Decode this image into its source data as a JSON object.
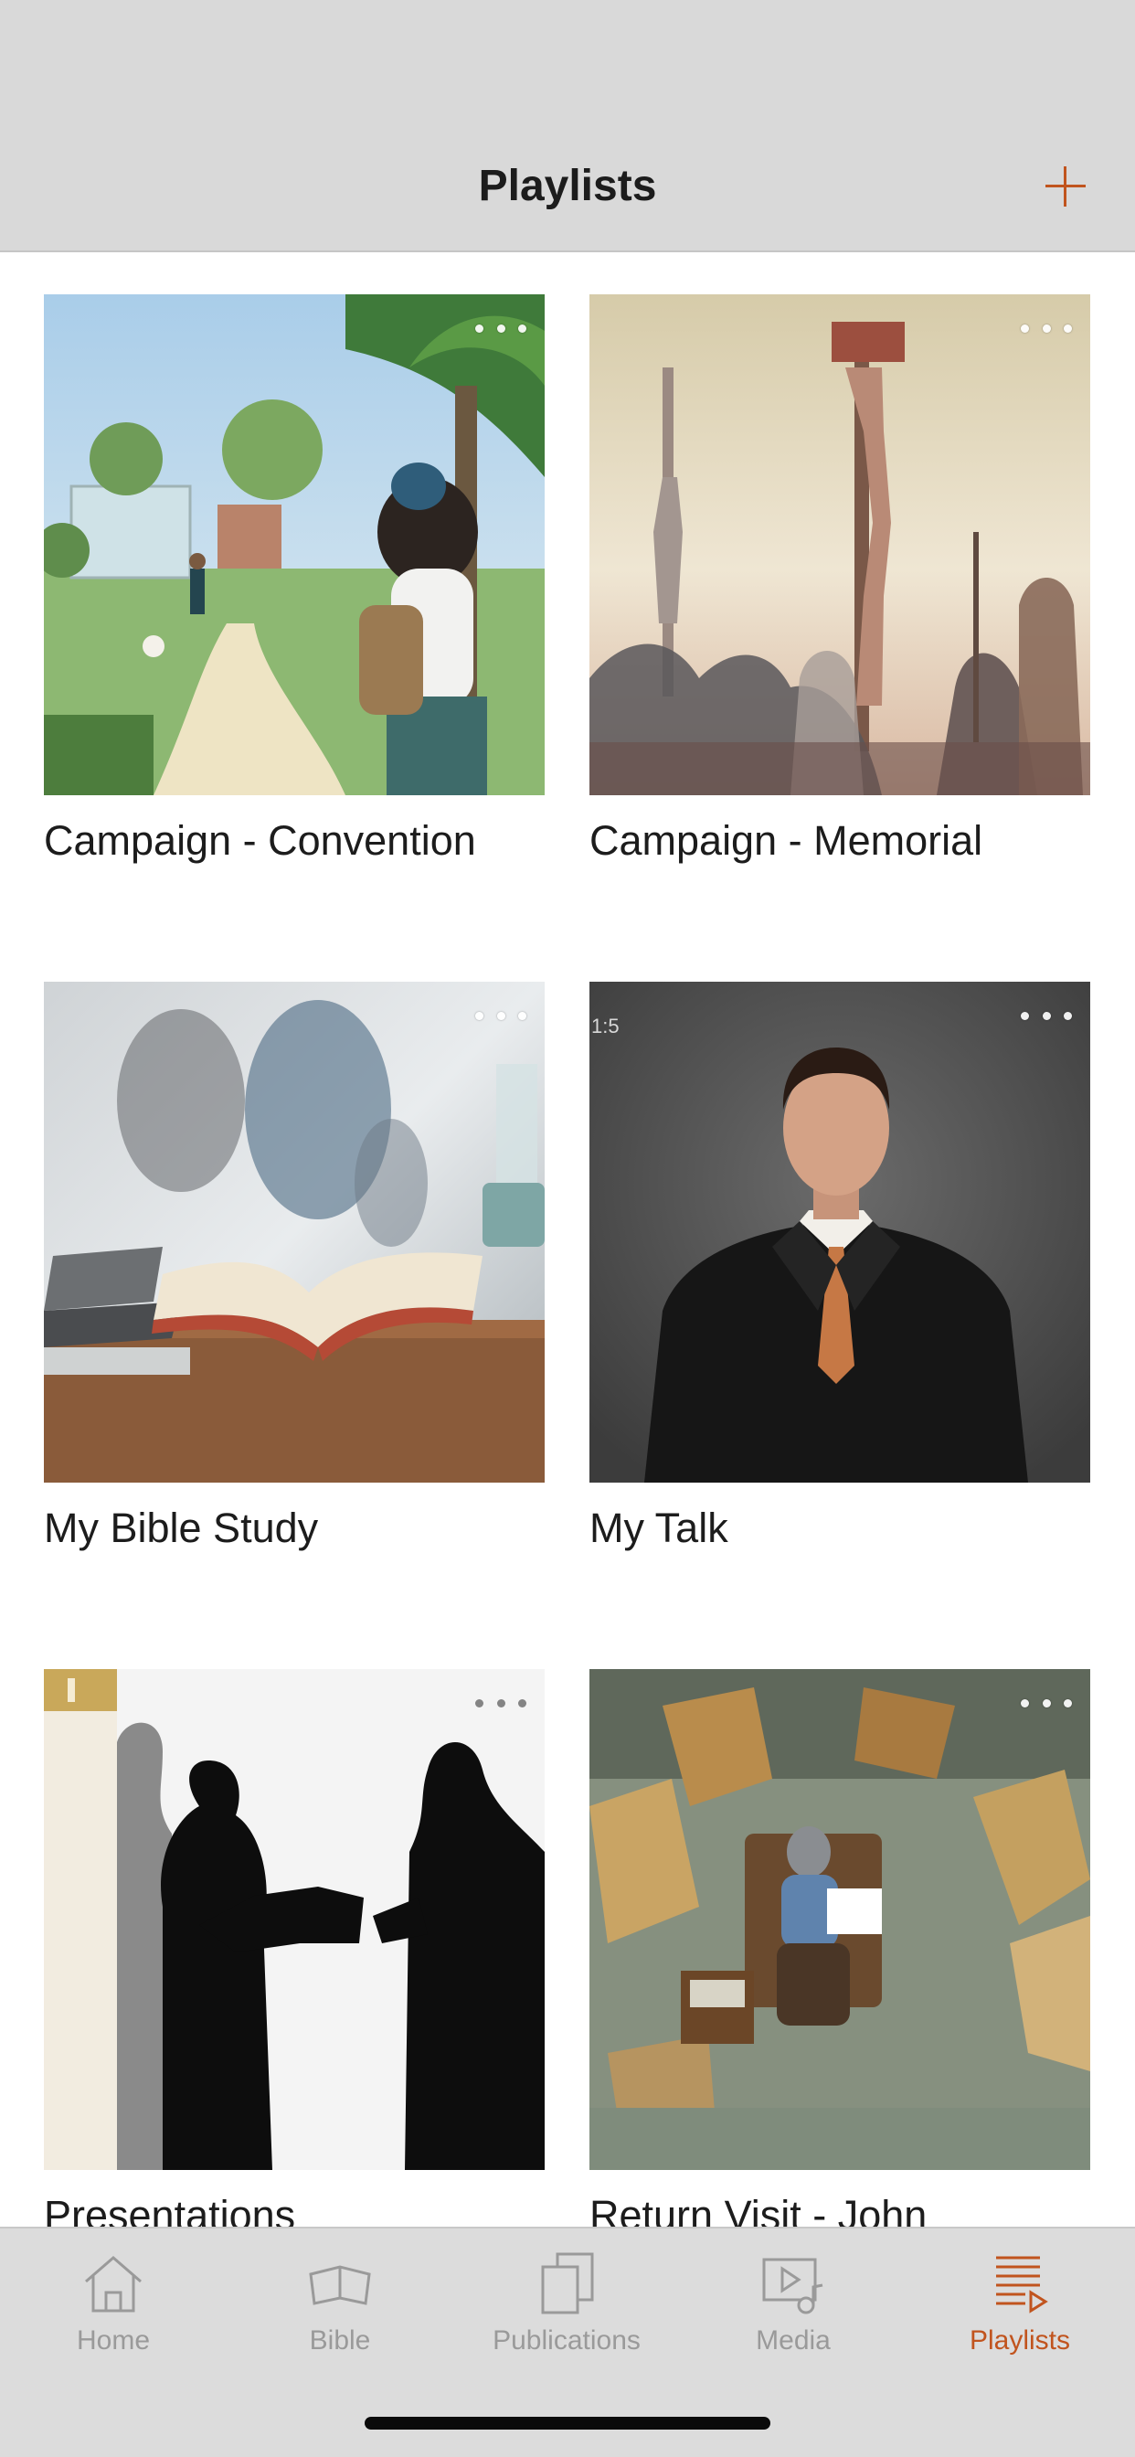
{
  "header": {
    "title": "Playlists",
    "add_icon": "plus-icon"
  },
  "playlists": [
    {
      "title": "Campaign - Convention",
      "more_icon": "more-horizontal-icon"
    },
    {
      "title": "Campaign - Memorial",
      "more_icon": "more-horizontal-icon"
    },
    {
      "title": "My Bible Study",
      "more_icon": "more-horizontal-icon"
    },
    {
      "title": "My Talk",
      "more_icon": "more-horizontal-icon",
      "thumb_text": "1:5"
    },
    {
      "title": "Presentations",
      "more_icon": "more-horizontal-icon"
    },
    {
      "title": "Return Visit - John",
      "more_icon": "more-horizontal-icon"
    }
  ],
  "tabs": [
    {
      "label": "Home",
      "icon": "house-icon",
      "active": false
    },
    {
      "label": "Bible",
      "icon": "open-book-icon",
      "active": false
    },
    {
      "label": "Publications",
      "icon": "stacked-pages-icon",
      "active": false
    },
    {
      "label": "Media",
      "icon": "media-play-icon",
      "active": false
    },
    {
      "label": "Playlists",
      "icon": "playlist-icon",
      "active": true
    }
  ],
  "colors": {
    "accent": "#c1541e",
    "header_bg": "#d9d9d9",
    "tabbar_bg": "#dcdcdc",
    "inactive": "#9a9a9a"
  }
}
